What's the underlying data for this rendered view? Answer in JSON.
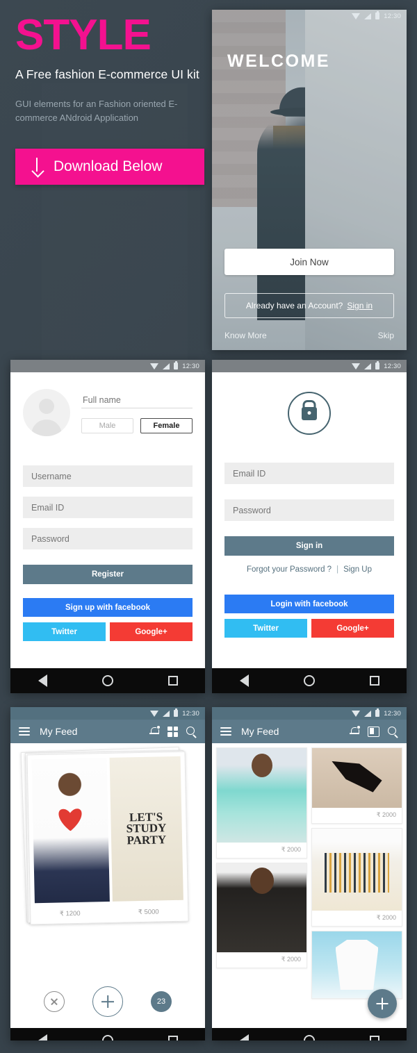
{
  "hero": {
    "title": "STYLE",
    "subtitle": "A Free fashion E-commerce UI kit",
    "description": "GUI elements for an Fashion oriented E-commerce ANdroid Application",
    "download_label": "Download Below",
    "accent_color": "#F4118F",
    "background_color": "#3b4750"
  },
  "status_bar": {
    "time": "12:30"
  },
  "welcome": {
    "title": "WELCOME",
    "join_label": "Join Now",
    "account_prompt": "Already have an Account?",
    "sign_in_link": "Sign in",
    "know_more": "Know More",
    "skip": "Skip"
  },
  "register": {
    "full_name_placeholder": "Full name",
    "gender": {
      "male": "Male",
      "female": "Female",
      "selected": "Female"
    },
    "username_placeholder": "Username",
    "email_placeholder": "Email ID",
    "password_placeholder": "Password",
    "register_label": "Register",
    "facebook_label": "Sign up with facebook",
    "twitter_label": "Twitter",
    "google_label": "Google+"
  },
  "signin": {
    "email_placeholder": "Email ID",
    "password_placeholder": "Password",
    "signin_label": "Sign in",
    "forgot_label": "Forgot your Password ?",
    "divider": "|",
    "signup_label": "Sign Up",
    "facebook_label": "Login with facebook",
    "twitter_label": "Twitter",
    "google_label": "Google+"
  },
  "feed_cards": {
    "title": "My Feed",
    "bag_text": "LET'S STUDY PARTY",
    "prices": [
      "₹ 1200",
      "₹ 5000"
    ],
    "count_badge": "23"
  },
  "feed_grid": {
    "title": "My Feed",
    "items": [
      {
        "name": "kimono",
        "price": "₹ 2000"
      },
      {
        "name": "heels",
        "price": "₹ 2000"
      },
      {
        "name": "dress",
        "price": "₹ 2000"
      },
      {
        "name": "crop-top",
        "price": "₹ 2000"
      },
      {
        "name": "shirt",
        "price": ""
      }
    ]
  },
  "theme": {
    "slate": "#5d7a8a",
    "facebook_blue": "#2b7bf3",
    "twitter_blue": "#31bdf2",
    "google_red": "#f43b34"
  }
}
